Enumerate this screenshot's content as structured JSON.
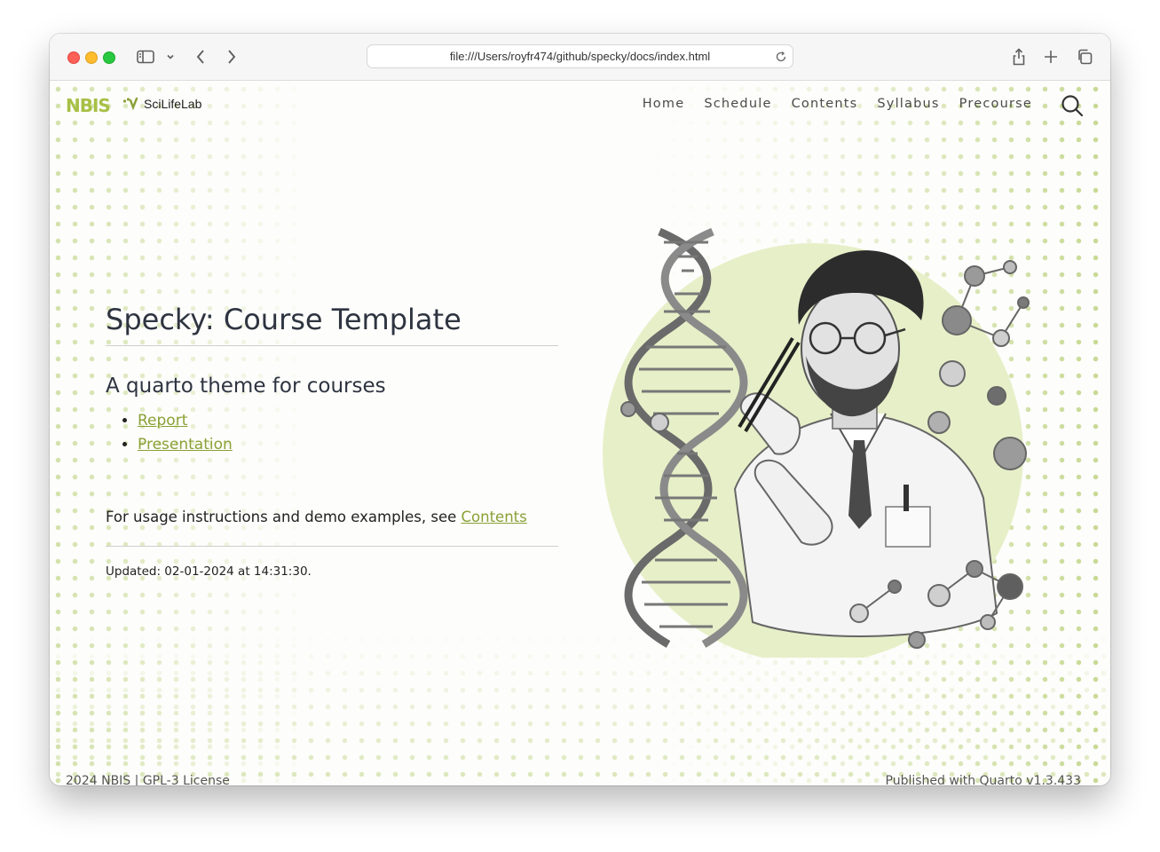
{
  "browser": {
    "url": "file:///Users/royfr474/github/specky/docs/index.html"
  },
  "navbar": {
    "logo_nbis": "NBIS",
    "logo_scilifelab": "SciLifeLab",
    "items": [
      {
        "label": "Home"
      },
      {
        "label": "Schedule"
      },
      {
        "label": "Contents"
      },
      {
        "label": "Syllabus"
      },
      {
        "label": "Precourse"
      }
    ]
  },
  "hero": {
    "title": "Specky: Course Template",
    "subtitle": "A quarto theme for courses",
    "links": [
      {
        "label": "Report"
      },
      {
        "label": "Presentation"
      }
    ],
    "usage_text": "For usage instructions and demo examples, see ",
    "usage_link": "Contents",
    "updated": "Updated: 02-01-2024 at 14:31:30."
  },
  "footer": {
    "year": "2024 ",
    "nbis_link": "NBIS",
    "separator": " | ",
    "license_link": "GPL-3 License",
    "published_prefix": "Published with ",
    "quarto_link": "Quarto",
    "version": " v1.3.433"
  },
  "colors": {
    "accent": "#8aa036",
    "logo_green": "#a7c046",
    "dots": "#c3d68c",
    "circle": "#e7efc8"
  },
  "icons": {
    "sidebar": "sidebar-icon",
    "back": "chevron-left-icon",
    "forward": "chevron-right-icon",
    "reload": "reload-icon",
    "share": "share-icon",
    "new_tab": "plus-icon",
    "tabs": "tabs-overview-icon",
    "search": "search-icon"
  }
}
